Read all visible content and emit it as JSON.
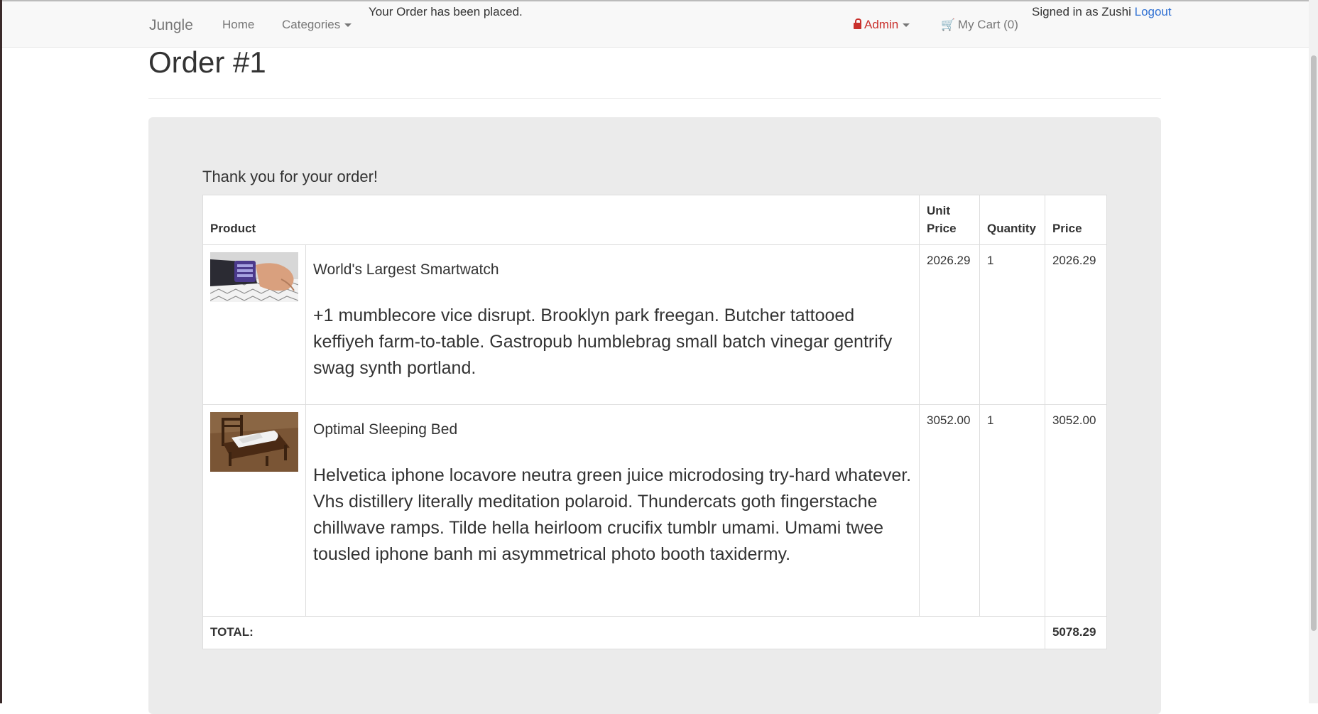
{
  "navbar": {
    "brand": "Jungle",
    "home": "Home",
    "categories": "Categories",
    "admin": "Admin",
    "cart": "My Cart (0)",
    "signed_in_prefix": "Signed in as Zushi",
    "logout": "Logout"
  },
  "flash": "Your Order has been placed.",
  "page": {
    "title": "Order #1",
    "thanks": "Thank you for your order!"
  },
  "table": {
    "headers": {
      "product": "Product",
      "unit_price": "Unit Price",
      "quantity": "Quantity",
      "price": "Price"
    },
    "rows": [
      {
        "name": "World's Largest Smartwatch",
        "description": "+1 mumblecore vice disrupt. Brooklyn park freegan. Butcher tattooed keffiyeh farm-to-table. Gastropub humblebrag small batch vinegar gentrify swag synth portland.",
        "unit_price": "2026.29",
        "quantity": "1",
        "price": "2026.29"
      },
      {
        "name": "Optimal Sleeping Bed",
        "description": "Helvetica iphone locavore neutra green juice microdosing try-hard whatever. Vhs distillery literally meditation polaroid. Thundercats goth fingerstache chillwave ramps. Tilde hella heirloom crucifix tumblr umami. Umami twee tousled iphone banh mi asymmetrical photo booth taxidermy.",
        "unit_price": "3052.00",
        "quantity": "1",
        "price": "3052.00"
      }
    ],
    "total_label": "TOTAL:",
    "total_value": "5078.29"
  },
  "colors": {
    "admin": "#c9302c",
    "link": "#3071d3",
    "well": "#ebebeb"
  },
  "icons": {
    "admin": "lock-icon",
    "cart": "cart-icon"
  }
}
